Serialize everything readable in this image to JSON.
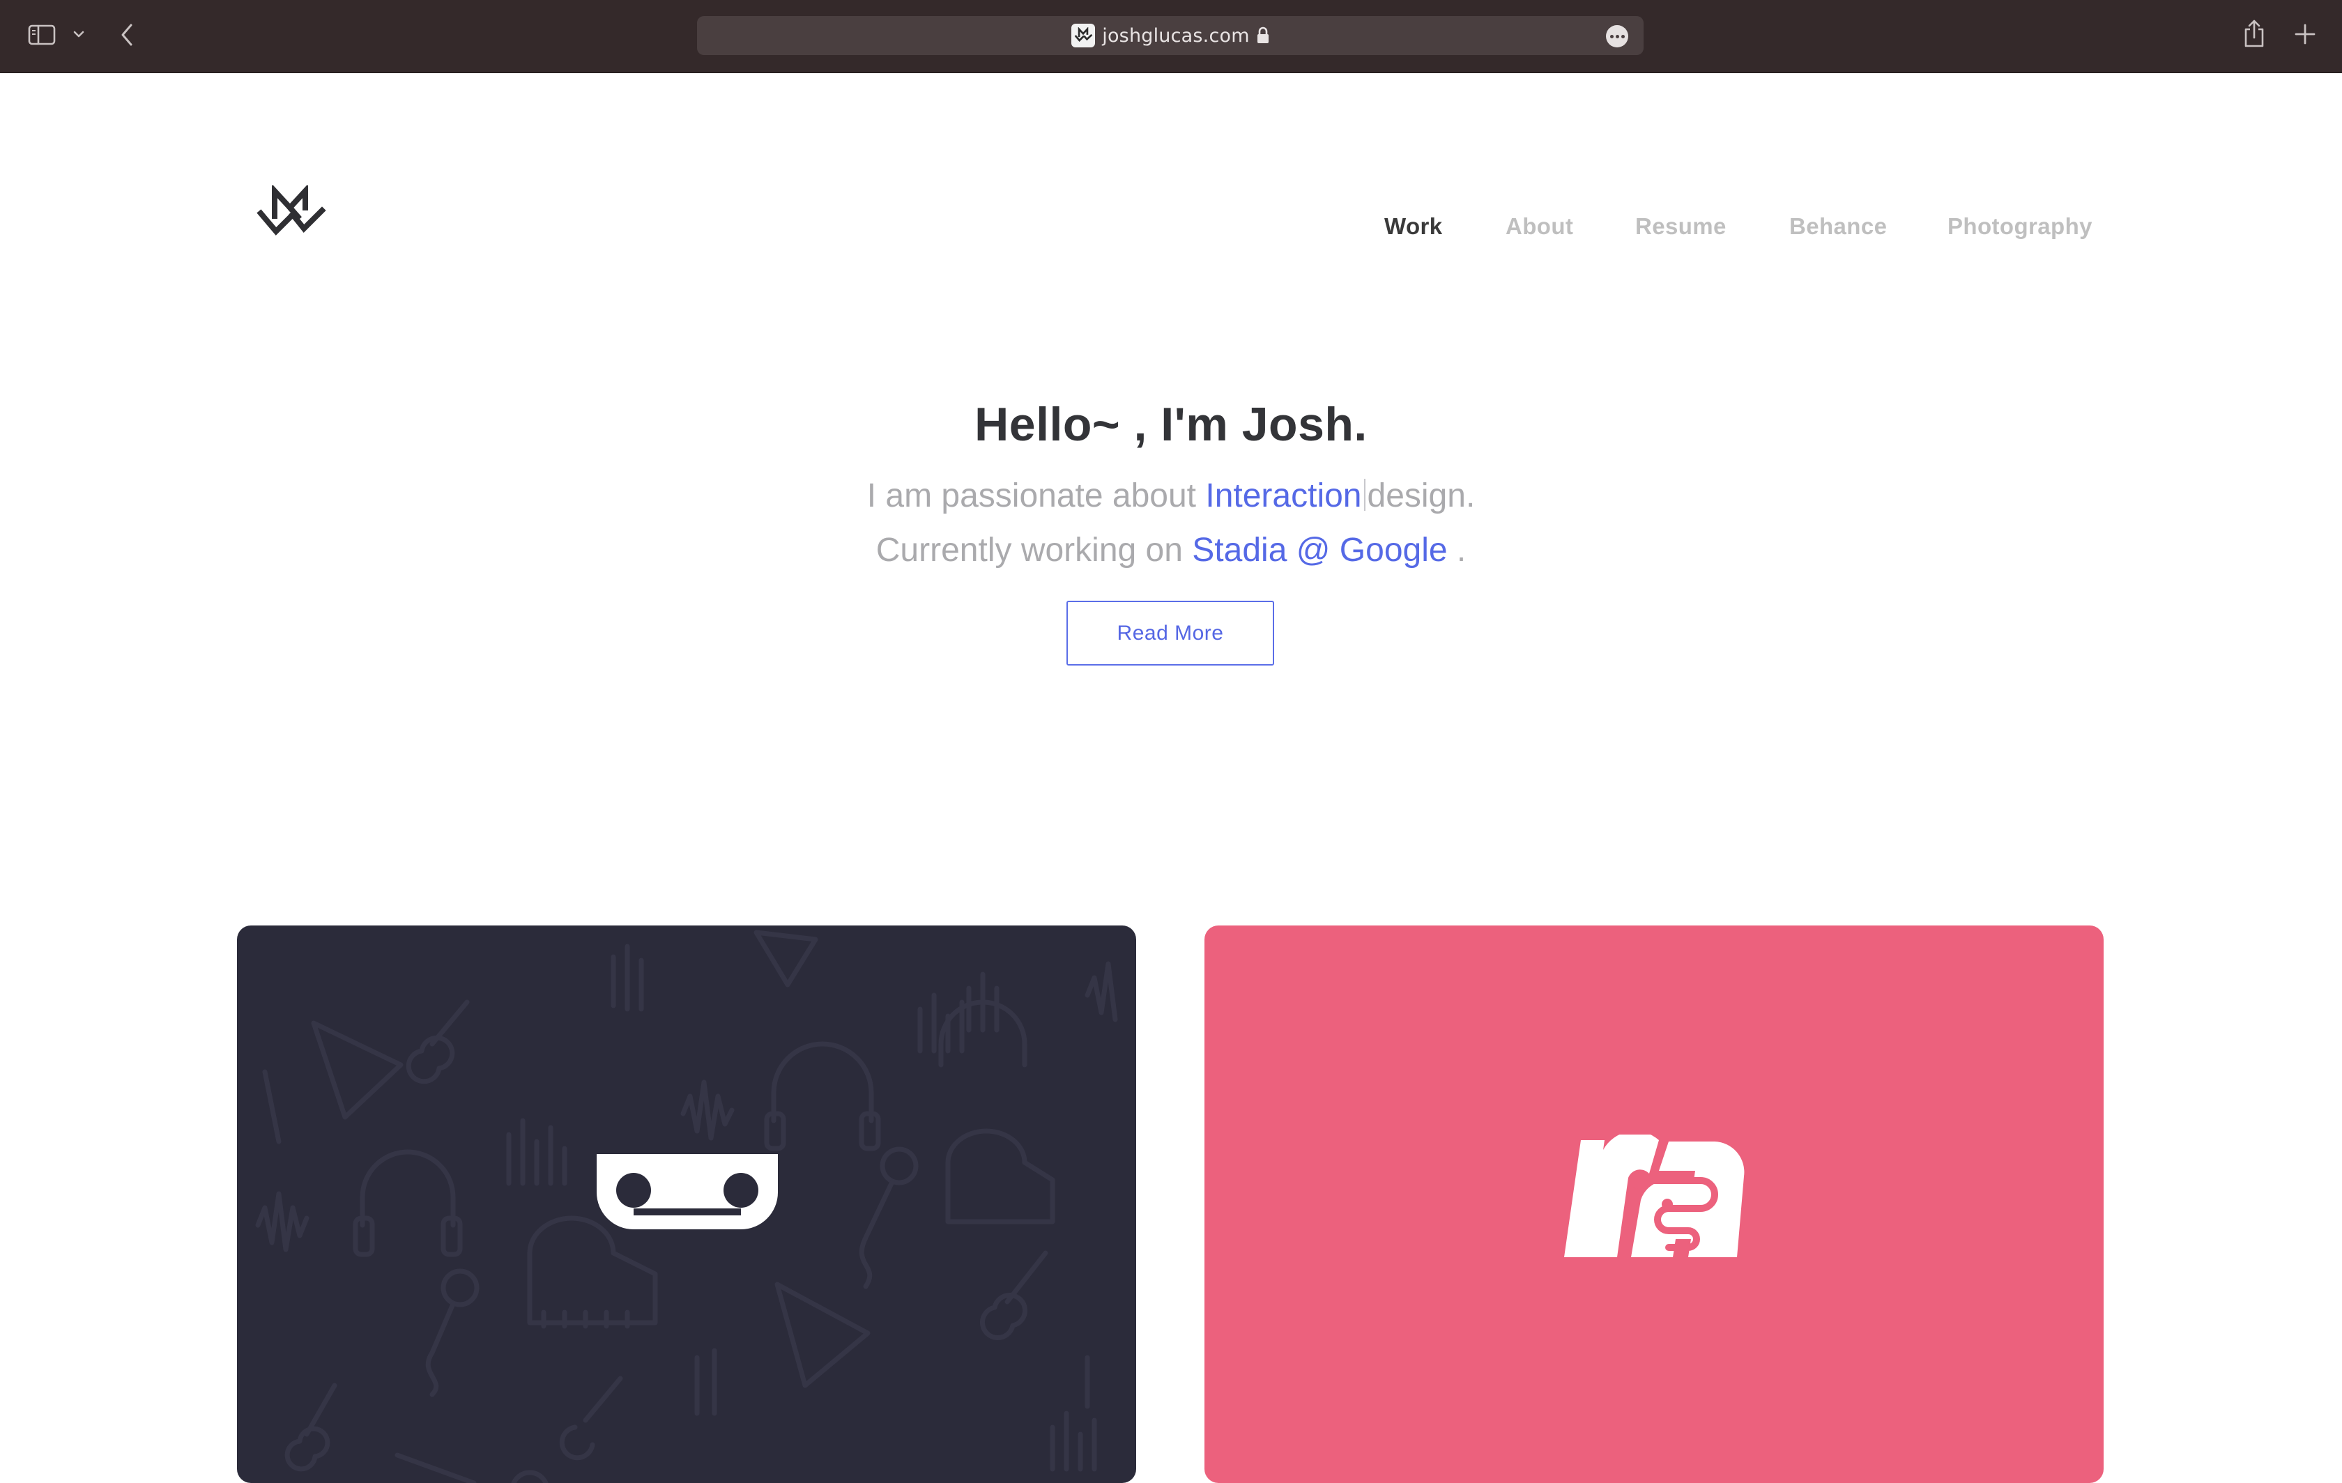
{
  "browser": {
    "url": "joshglucas.com",
    "icons": [
      "sidebar-icon",
      "chevron-down-icon",
      "back-icon",
      "lock-icon",
      "more-icon",
      "share-icon",
      "new-tab-icon"
    ]
  },
  "nav": {
    "items": [
      {
        "label": "Work",
        "active": true
      },
      {
        "label": "About",
        "active": false
      },
      {
        "label": "Resume",
        "active": false
      },
      {
        "label": "Behance",
        "active": false
      },
      {
        "label": "Photography",
        "active": false
      }
    ]
  },
  "hero": {
    "title": "Hello~ , I'm Josh.",
    "line1_prefix": "I am passionate about ",
    "line1_highlight": "Interaction",
    "line1_suffix": "design.",
    "line2_prefix": "Currently working on ",
    "line2_highlight": "Stadia @ Google",
    "line2_suffix": " .",
    "button_label": "Read More"
  },
  "projects": [
    {
      "icon": "voicemail-icon",
      "background": "#2b2b3a"
    },
    {
      "icon": "ra-monogram-icon",
      "background": "#ec617d"
    }
  ],
  "colors": {
    "accent": "#5569e6",
    "chrome": "#34292a",
    "nav_active": "#3a3a3a",
    "nav_inactive": "#bfbfbf"
  }
}
